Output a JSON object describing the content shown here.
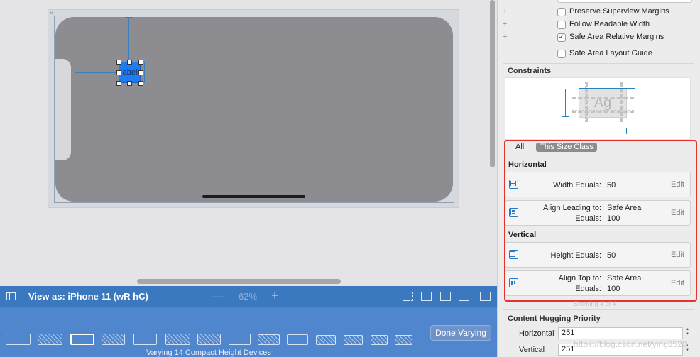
{
  "inspector": {
    "checkboxes": [
      {
        "label": "Preserve Superview Margins",
        "checked": "",
        "plus": "+"
      },
      {
        "label": "Follow Readable Width",
        "checked": "",
        "plus": "+"
      },
      {
        "label": "Safe Area Relative Margins",
        "checked": "✓",
        "plus": "+"
      },
      {
        "label": "Safe Area Layout Guide",
        "checked": "",
        "plus": ""
      }
    ],
    "constraints_title": "Constraints",
    "preview_text": "Ag",
    "segment": {
      "all": "All",
      "size_class": "This Size Class"
    },
    "horizontal_title": "Horizontal",
    "vertical_title": "Vertical",
    "constraints": {
      "width": {
        "name": "Width Equals:",
        "value": "50",
        "edit": "Edit"
      },
      "align_leading": {
        "name": "Align Leading to:",
        "target": "Safe Area",
        "equals_label": "Equals:",
        "value": "100",
        "edit": "Edit"
      },
      "height": {
        "name": "Height Equals:",
        "value": "50",
        "edit": "Edit"
      },
      "align_top": {
        "name": "Align Top to:",
        "target": "Safe Area",
        "equals_label": "Equals:",
        "value": "100",
        "edit": "Edit"
      }
    },
    "showing": "Showing 4 of 4",
    "content_hugging": {
      "title": "Content Hugging Priority",
      "horizontal_label": "Horizontal",
      "horizontal_value": "251",
      "vertical_label": "Vertical",
      "vertical_value": "251"
    },
    "watermark": "https://blog.csdn.net/ying8520"
  },
  "canvas": {
    "label_text": "abel"
  },
  "view_as": {
    "text": "View as: iPhone 11 (wR hC)",
    "zoom": "62%",
    "minus": "—",
    "plus": "+"
  },
  "device_bar": {
    "done_label": "Done Varying",
    "varying_text": "Varying 14 Compact Height Devices"
  },
  "colors": {
    "accent_blue": "#3a78c0",
    "highlight_red": "#e5322d",
    "constraint_blue": "#2784b8"
  }
}
